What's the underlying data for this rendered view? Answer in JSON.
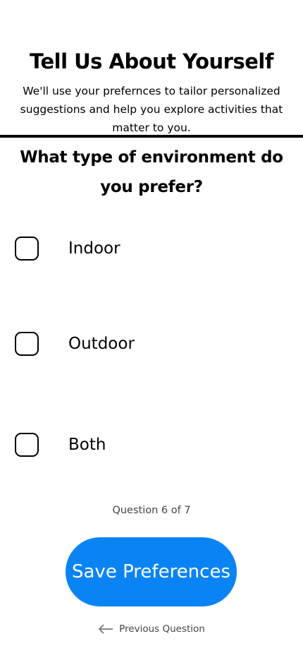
{
  "header": {
    "title": "Tell Us About Yourself",
    "subtitle": "We'll use your prefernces to tailor personalized suggestions and help you explore activities that matter to you."
  },
  "question": {
    "text": "What type of environment do you prefer?",
    "options": [
      {
        "label": "Indoor",
        "checked": false
      },
      {
        "label": "Outdoor",
        "checked": false
      },
      {
        "label": "Both",
        "checked": false
      }
    ]
  },
  "progress": {
    "label": "Question 6 of 7",
    "current": 6,
    "total": 7
  },
  "actions": {
    "save_label": "Save Preferences",
    "previous_label": "Previous Question"
  },
  "colors": {
    "accent": "#0a84f5"
  }
}
